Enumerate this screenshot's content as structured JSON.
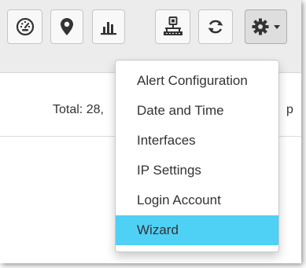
{
  "toolbar": {
    "buttons": [
      {
        "icon": "speedometer-icon"
      },
      {
        "icon": "map-marker-icon"
      },
      {
        "icon": "bar-chart-icon"
      },
      {
        "icon": "network-icon"
      },
      {
        "icon": "refresh-icon"
      },
      {
        "icon": "gear-icon",
        "has_dropdown": true
      }
    ]
  },
  "summary": {
    "total_text": "Total: 28,",
    "trailing_text": "p"
  },
  "menu": {
    "items": [
      {
        "label": "Alert Configuration"
      },
      {
        "label": "Date and Time"
      },
      {
        "label": "Interfaces"
      },
      {
        "label": "IP Settings"
      },
      {
        "label": "Login Account"
      },
      {
        "label": "Wizard",
        "highlighted": true
      }
    ],
    "highlight_color": "#4fd0f5"
  }
}
